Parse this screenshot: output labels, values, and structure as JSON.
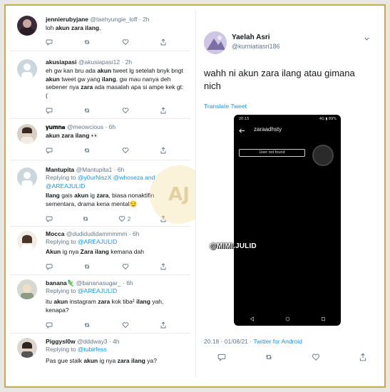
{
  "tweets": [
    {
      "name": "jennierubyjane",
      "handle": "@taehyungie_loff",
      "time": "· 2h",
      "body": [
        {
          "t": "loh "
        },
        {
          "t": "akun zara ilang",
          "b": true
        },
        {
          "t": ","
        }
      ],
      "replies": "",
      "likes": ""
    },
    {
      "name": "akusiapasi",
      "handle": "@akusiapasi12",
      "time": "· 2h",
      "body": [
        {
          "t": "eh gw kan bru ada "
        },
        {
          "t": "akun",
          "b": true
        },
        {
          "t": " tweet lg setelah bnyk bngt "
        },
        {
          "t": "akun",
          "b": true
        },
        {
          "t": " tweet gw yang "
        },
        {
          "t": "ilang",
          "b": true
        },
        {
          "t": ", gw mau nanya deh sebener nya "
        },
        {
          "t": "zara",
          "b": true
        },
        {
          "t": " ada masalah apa si ampe kek gt:("
        }
      ]
    },
    {
      "name": "𝐲𝐮𝐦𝐧𝐚",
      "handle": "@meowcious",
      "time": "· 6h",
      "body": [
        {
          "t": "akun zara ilang",
          "b": true
        },
        {
          "t": " 👀"
        }
      ]
    },
    {
      "name": "Mantupita",
      "handle": "@Mantupita1",
      "time": "· 6h",
      "reply_label": "Replying to",
      "reply_to": "@y0urNiszX @whoseza and @AREAJULID",
      "body": [
        {
          "t": "Ilang",
          "b": true
        },
        {
          "t": " gais "
        },
        {
          "t": "akun",
          "b": true
        },
        {
          "t": " ig "
        },
        {
          "t": "zara",
          "b": true
        },
        {
          "t": ", biasa nonaktifin sementara, drama kena mental😏"
        }
      ],
      "likes": "2"
    },
    {
      "name": "Mocca",
      "handle": "@dudidudidammmmm",
      "time": "· 6h",
      "reply_label": "Replying to",
      "reply_to": "@AREAJULID",
      "body": [
        {
          "t": "Akun",
          "b": true
        },
        {
          "t": " ig nya "
        },
        {
          "t": "Zara",
          "b": true
        },
        {
          "t": " "
        },
        {
          "t": "ilang",
          "b": true
        },
        {
          "t": " kemana dah"
        }
      ]
    },
    {
      "name": "banana🦎",
      "handle": "@bananasugar_",
      "time": "· 6h",
      "reply_label": "Replying to",
      "reply_to": "@AREAJULID",
      "body": [
        {
          "t": "itu "
        },
        {
          "t": "akun",
          "b": true
        },
        {
          "t": " instagram "
        },
        {
          "t": "zara",
          "b": true
        },
        {
          "t": " kok tiba² "
        },
        {
          "t": "ilang",
          "b": true
        },
        {
          "t": " yah, kenapa?"
        }
      ]
    },
    {
      "name": "Piggysl0w",
      "handle": "@dddway3",
      "time": "· 4h",
      "reply_label": "Replying to",
      "reply_to": "@tubirfess",
      "body": [
        {
          "t": "Pas gue stalk "
        },
        {
          "t": "akun",
          "b": true
        },
        {
          "t": " ig nya "
        },
        {
          "t": "zara",
          "b": true
        },
        {
          "t": " "
        },
        {
          "t": "ilang",
          "b": true
        },
        {
          "t": " ya?"
        }
      ]
    }
  ],
  "main_tweet": {
    "name": "Yaelah Asri",
    "handle": "@kurniatiasri186",
    "text": "wahh ni akun zara ilang atau gimana nich",
    "translate": "Translate Tweet",
    "timestamp": "20.18 · 01/08/21 · ",
    "source": "Twitter for Android"
  },
  "phone": {
    "time": "20:15",
    "status_right": "4G ▮ 89%",
    "title": "zaraadhsty",
    "not_found": "User not found"
  },
  "overlay": {
    "handle": "@MIMI.JULID",
    "watermark": "AJ"
  },
  "colors": {
    "link": "#1b95e0",
    "muted": "#657786",
    "frame": "#caa84e"
  }
}
